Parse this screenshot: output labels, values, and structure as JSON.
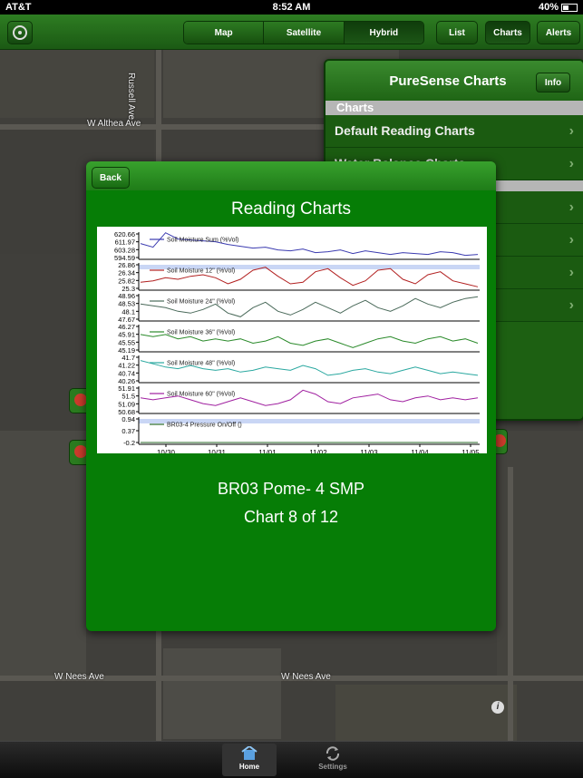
{
  "status": {
    "carrier": "AT&T",
    "time": "8:52 AM",
    "battery": "40%"
  },
  "toolbar": {
    "map_types": [
      {
        "label": "Map",
        "active": false
      },
      {
        "label": "Satellite",
        "active": false
      },
      {
        "label": "Hybrid",
        "active": true
      }
    ],
    "list_label": "List",
    "charts_label": "Charts",
    "alerts_label": "Alerts"
  },
  "map": {
    "labels": [
      "W Althea Ave",
      "Russell Ave",
      "W Nees Ave",
      "W Nees Ave"
    ]
  },
  "charts_menu": {
    "title": "PureSense Charts",
    "info_label": "Info",
    "section": "Charts",
    "items": [
      "Default Reading Charts",
      "Water Balance Charts"
    ]
  },
  "dialog": {
    "back_label": "Back",
    "title": "Reading Charts",
    "station": "BR03 Pome- 4 SMP",
    "counter": "Chart 8 of 12"
  },
  "chart_data": {
    "type": "line",
    "x_ticks": [
      "10/30",
      "10/31",
      "11/01",
      "11/02",
      "11/03",
      "11/04",
      "11/05"
    ],
    "panels": [
      {
        "name": "Soil Moisture Sum (%Vol)",
        "color": "#3b3bb0",
        "yticks": [
          "620.66",
          "611.97",
          "603.28",
          "594.59"
        ],
        "values": [
          610,
          606,
          622,
          615,
          614,
          613,
          612,
          609,
          607,
          605,
          606,
          603,
          602,
          604,
          600,
          601,
          603,
          599,
          602,
          600,
          598,
          600,
          599,
          598,
          601,
          600,
          597,
          598
        ]
      },
      {
        "name": "Soil Moisture 12\" (%Vol)",
        "color": "#b22020",
        "yticks": [
          "26.86",
          "26.34",
          "25.82",
          "25.3"
        ],
        "values": [
          25.7,
          25.8,
          26.0,
          25.9,
          26.1,
          26.2,
          26.0,
          25.6,
          25.9,
          26.5,
          26.7,
          26.1,
          25.6,
          25.7,
          26.4,
          26.6,
          26.0,
          25.5,
          25.8,
          26.5,
          26.6,
          25.9,
          25.6,
          26.2,
          26.4,
          25.8,
          25.6,
          25.4
        ]
      },
      {
        "name": "Soil Moisture 24\" (%Vol)",
        "color": "#4a6a5a",
        "yticks": [
          "48.96",
          "48.53",
          "48.1",
          "47.67"
        ],
        "values": [
          48.5,
          48.4,
          48.3,
          48.1,
          48.0,
          48.2,
          48.5,
          48.0,
          47.8,
          48.3,
          48.6,
          48.1,
          47.9,
          48.2,
          48.6,
          48.3,
          48.0,
          48.4,
          48.7,
          48.3,
          48.1,
          48.4,
          48.8,
          48.5,
          48.3,
          48.6,
          48.8,
          48.9
        ]
      },
      {
        "name": "Soil Moisture 36\" (%Vol)",
        "color": "#2a8a2a",
        "yticks": [
          "46.27",
          "45.91",
          "45.55",
          "45.19"
        ],
        "values": [
          45.9,
          45.8,
          45.9,
          45.7,
          45.8,
          45.6,
          45.7,
          45.6,
          45.7,
          45.5,
          45.6,
          45.8,
          45.5,
          45.4,
          45.6,
          45.7,
          45.5,
          45.3,
          45.5,
          45.7,
          45.8,
          45.6,
          45.5,
          45.7,
          45.8,
          45.6,
          45.7,
          45.5
        ]
      },
      {
        "name": "Soil Moisture 48\" (%Vol)",
        "color": "#2aa8a0",
        "yticks": [
          "41.7",
          "41.22",
          "40.74",
          "40.26"
        ],
        "values": [
          41.5,
          41.3,
          41.1,
          41.0,
          41.2,
          41.0,
          40.9,
          41.0,
          40.8,
          40.9,
          41.1,
          41.0,
          40.9,
          41.2,
          41.0,
          40.6,
          40.7,
          40.9,
          41.0,
          40.8,
          40.7,
          40.9,
          41.1,
          40.9,
          40.7,
          40.8,
          40.7,
          40.6
        ]
      },
      {
        "name": "Soil Moisture 60\" (%Vol)",
        "color": "#a020a0",
        "yticks": [
          "51.91",
          "51.5",
          "51.09",
          "50.68"
        ],
        "values": [
          51.4,
          51.3,
          51.4,
          51.5,
          51.3,
          51.1,
          51.0,
          51.2,
          51.4,
          51.2,
          51.0,
          51.1,
          51.3,
          51.8,
          51.6,
          51.2,
          51.1,
          51.4,
          51.5,
          51.6,
          51.3,
          51.2,
          51.4,
          51.5,
          51.3,
          51.4,
          51.3,
          51.4
        ]
      },
      {
        "name": "BR03-4 Pressure On/Off ()",
        "color": "#2a6a2a",
        "yticks": [
          "0.94",
          "0.37",
          "-0.2"
        ],
        "values": [
          -0.2,
          -0.2,
          -0.2,
          -0.2,
          -0.2,
          -0.2,
          -0.2,
          -0.2,
          -0.2,
          -0.2,
          -0.2,
          -0.2,
          -0.2,
          -0.2,
          -0.2,
          -0.2,
          -0.2,
          -0.2,
          -0.2,
          -0.2,
          -0.2,
          -0.2,
          -0.2,
          -0.2,
          -0.2,
          -0.2,
          -0.2,
          -0.2
        ]
      }
    ]
  },
  "tabs": [
    {
      "label": "Home",
      "active": true
    },
    {
      "label": "Settings",
      "active": false
    }
  ]
}
